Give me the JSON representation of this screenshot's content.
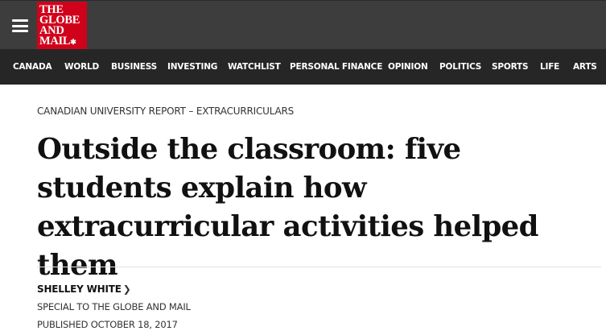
{
  "header": {
    "logo_lines": [
      "THE",
      "GLOBE",
      "AND",
      "MAIL"
    ],
    "menu_icon": "hamburger-menu-icon",
    "logo_icon": "maple-leaf-icon",
    "colors": {
      "topbar": "#3d3d3d",
      "navbar": "#262626",
      "logo_red": "#d0021b"
    }
  },
  "nav": {
    "items": [
      "CANADA",
      "WORLD",
      "BUSINESS",
      "INVESTING",
      "WATCHLIST",
      "PERSONAL FINANCE",
      "OPINION",
      "POLITICS",
      "SPORTS",
      "LIFE",
      "ARTS"
    ]
  },
  "article": {
    "kicker": "CANADIAN UNIVERSITY REPORT – EXTRACURRICULARS",
    "headline": "Outside the classroom: five students explain how extracurricular activities helped them",
    "author": "SHELLEY WHITE",
    "author_icon": "chevron-right-icon",
    "special": "SPECIAL TO THE GLOBE AND MAIL",
    "published": "PUBLISHED OCTOBER 18, 2017"
  }
}
